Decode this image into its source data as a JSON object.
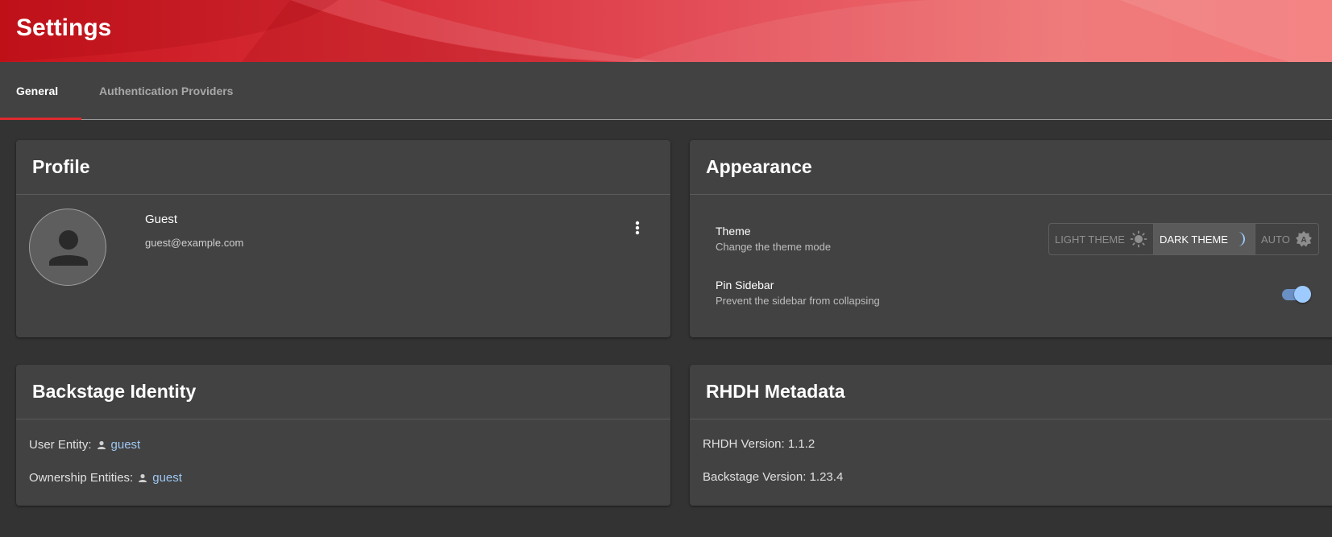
{
  "header": {
    "title": "Settings",
    "color": "#d8303a"
  },
  "tabs": [
    {
      "label": "General",
      "active": true
    },
    {
      "label": "Authentication Providers",
      "active": false
    }
  ],
  "profile": {
    "title": "Profile",
    "name": "Guest",
    "email": "guest@example.com",
    "avatar_icon": "person-icon",
    "menu_icon": "more-vert-icon"
  },
  "appearance": {
    "title": "Appearance",
    "theme": {
      "title": "Theme",
      "description": "Change the theme mode",
      "options": [
        {
          "label": "LIGHT THEME",
          "icon": "sun-icon",
          "selected": false
        },
        {
          "label": "DARK THEME",
          "icon": "moon-icon",
          "selected": true
        },
        {
          "label": "AUTO",
          "icon": "auto-theme-icon",
          "selected": false
        }
      ]
    },
    "pin_sidebar": {
      "title": "Pin Sidebar",
      "description": "Prevent the sidebar from collapsing",
      "enabled": true
    }
  },
  "identity": {
    "title": "Backstage Identity",
    "user_entity_label": "User Entity:",
    "user_entity_value": "guest",
    "ownership_label": "Ownership Entities:",
    "ownership_value": "guest"
  },
  "metadata": {
    "title": "RHDH Metadata",
    "rhdh_version": "RHDH Version: 1.1.2",
    "backstage_version": "Backstage Version: 1.23.4"
  },
  "colors": {
    "accent": "#e0282f",
    "link": "#9ec7f2",
    "toggle": "#9ecbff"
  }
}
